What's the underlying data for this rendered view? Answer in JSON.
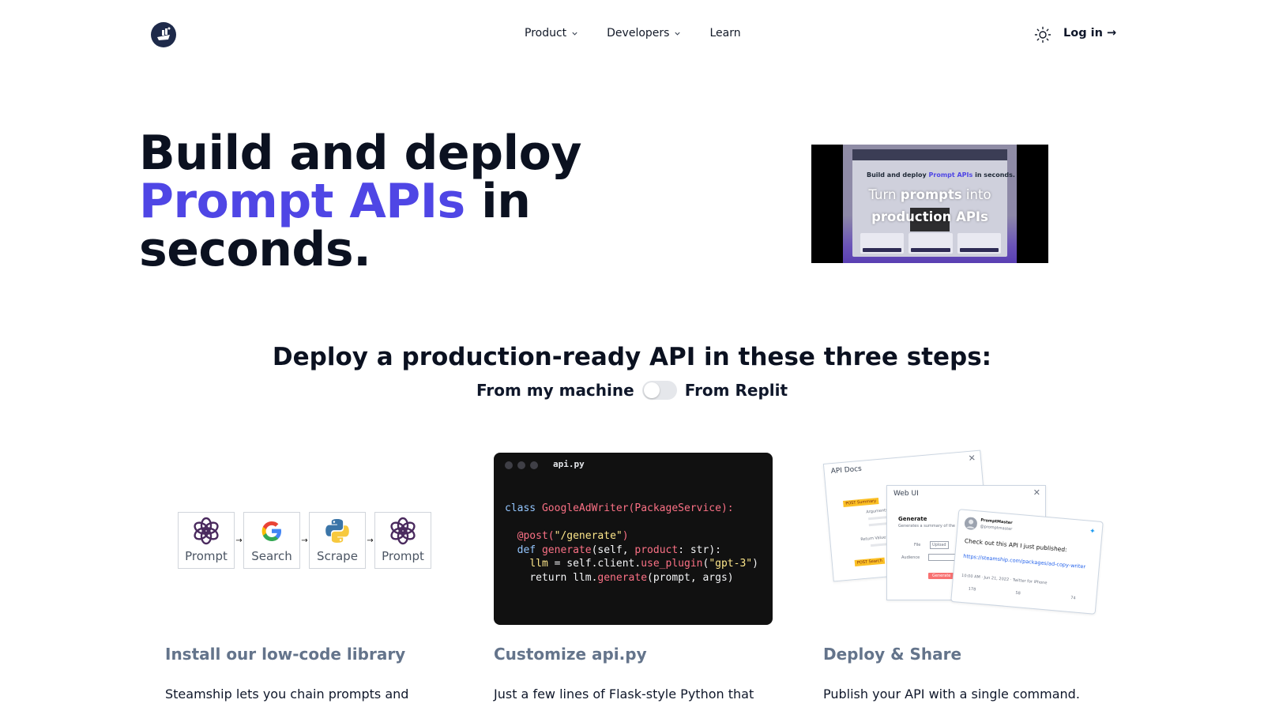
{
  "nav": {
    "logo_icon": "steamship-logo-icon",
    "links": [
      {
        "label": "Product",
        "has_dropdown": true
      },
      {
        "label": "Developers",
        "has_dropdown": true
      },
      {
        "label": "Learn",
        "has_dropdown": false
      }
    ],
    "theme_icon": "sun-icon",
    "login_label": "Log in →"
  },
  "hero": {
    "title_part1": "Build and deploy",
    "title_accent": "Prompt APIs",
    "title_part2": " in",
    "title_part3": "seconds.",
    "accent_color": "#4f46e5",
    "video": {
      "headline_part1": "Build and deploy ",
      "headline_accent": "Prompt APIs",
      "headline_part2": " in seconds.",
      "caption_line1_a": "Turn ",
      "caption_line1_b": "prompts",
      "caption_line1_c": " into",
      "caption_line2_a": "production",
      "caption_line2_b": " APIs"
    }
  },
  "steps": {
    "title": "Deploy a production-ready API in these three steps:",
    "toggle_left": "From my machine",
    "toggle_right": "From Replit",
    "toggle_on": false,
    "items": [
      {
        "title": "Install our low-code library",
        "body": "Steamship lets you chain prompts and"
      },
      {
        "title": "Customize api.py",
        "body": "Just a few lines of Flask-style Python that"
      },
      {
        "title": "Deploy & Share",
        "body": "Publish your API with a single command."
      }
    ]
  },
  "pipeline": [
    {
      "label": "Prompt",
      "icon": "openai-icon"
    },
    {
      "label": "Search",
      "icon": "google-icon"
    },
    {
      "label": "Scrape",
      "icon": "python-icon"
    },
    {
      "label": "Prompt",
      "icon": "openai-icon"
    }
  ],
  "pipeline_arrow": "→",
  "code": {
    "filename": "api.py",
    "l1_kw": "class ",
    "l1_cls": "GoogleAdWriter(PackageService):",
    "l2_dec": "@post(",
    "l2_str": "\"/generate\"",
    "l2_end": ")",
    "l3_kw": "def ",
    "l3_fn": "generate",
    "l3_a": "(self, ",
    "l3_b": "product",
    "l3_c": ": str):",
    "l4_a": "llm",
    "l4_b": " = self.client.",
    "l4_c": "use_plugin",
    "l4_d": "(",
    "l4_e": "\"gpt-3\"",
    "l4_f": ")",
    "l5_a": "return llm.",
    "l5_b": "generate",
    "l5_c": "(prompt, args)"
  },
  "collage": {
    "api_docs_title": "API Docs",
    "web_ui_title": "Web UI",
    "post_summary": "POST Summary",
    "post_search": "POST Search",
    "arguments": "Arguments:",
    "return_value": "Return Value:",
    "generate_heading": "Generate",
    "generate_sub": "Generates a summary of the",
    "file_label": "File",
    "upload_label": "Upload",
    "audience_label": "Audience",
    "generate_button": "Generate",
    "tweet_user": "PromptMaster",
    "tweet_handle": "@promptmaster",
    "tweet_text": "Check out this API I just published:",
    "tweet_link": "https://steamship.com/packages/ad-copy-writer",
    "tweet_meta": "10:00 AM · Jun 21, 2022 · Twitter for iPhone",
    "tweet_replies": "178",
    "tweet_retweets": "58",
    "tweet_likes": "74"
  }
}
